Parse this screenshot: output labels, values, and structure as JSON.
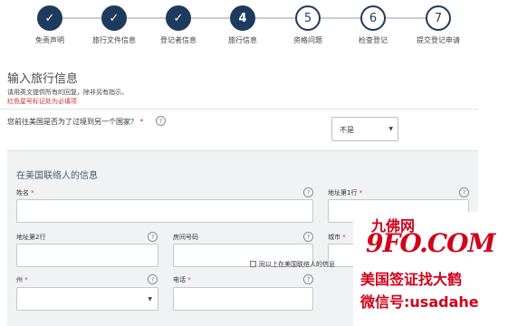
{
  "progress": {
    "steps": [
      {
        "num": "",
        "label": "免责声明",
        "state": "done"
      },
      {
        "num": "",
        "label": "旅行文件信息",
        "state": "done"
      },
      {
        "num": "",
        "label": "登记者信息",
        "state": "done"
      },
      {
        "num": "4",
        "label": "旅行信息",
        "state": "current"
      },
      {
        "num": "5",
        "label": "资格问题",
        "state": "todo"
      },
      {
        "num": "6",
        "label": "检查登记",
        "state": "todo"
      },
      {
        "num": "7",
        "label": "提交登记申请",
        "state": "todo"
      }
    ],
    "check_glyph": "✓"
  },
  "form": {
    "section_title": "输入旅行信息",
    "note_english": "请用英文提供所有的回复，除非另有指示。",
    "note_required": "红色星号标记处为必填项",
    "transit_question": "您前往美国是否为了过境到另一个国家？",
    "transit_value": "不是",
    "required_mark": "*",
    "help_glyph": "?",
    "caret_glyph": "▼"
  },
  "contact": {
    "title": "在美国联络人的信息",
    "name_label": "姓名",
    "address1_label": "地址第1行",
    "address2_label": "地址第2行",
    "apt_label": "房间号码",
    "city_label": "城市",
    "state_label": "州",
    "phone_label": "电话",
    "checkbox_label": "同以上在美国联络人的信息"
  },
  "watermark": {
    "site_name": "九佛网",
    "site_logo": "9FO.COM",
    "line1": "美国签证找大鹤",
    "line2": "微信号:usadahe"
  },
  "colors": {
    "step_fill": "#1f3a5f",
    "required": "#d0312d",
    "panel_bg": "#f1f2f4",
    "watermark": "#d0021b"
  }
}
